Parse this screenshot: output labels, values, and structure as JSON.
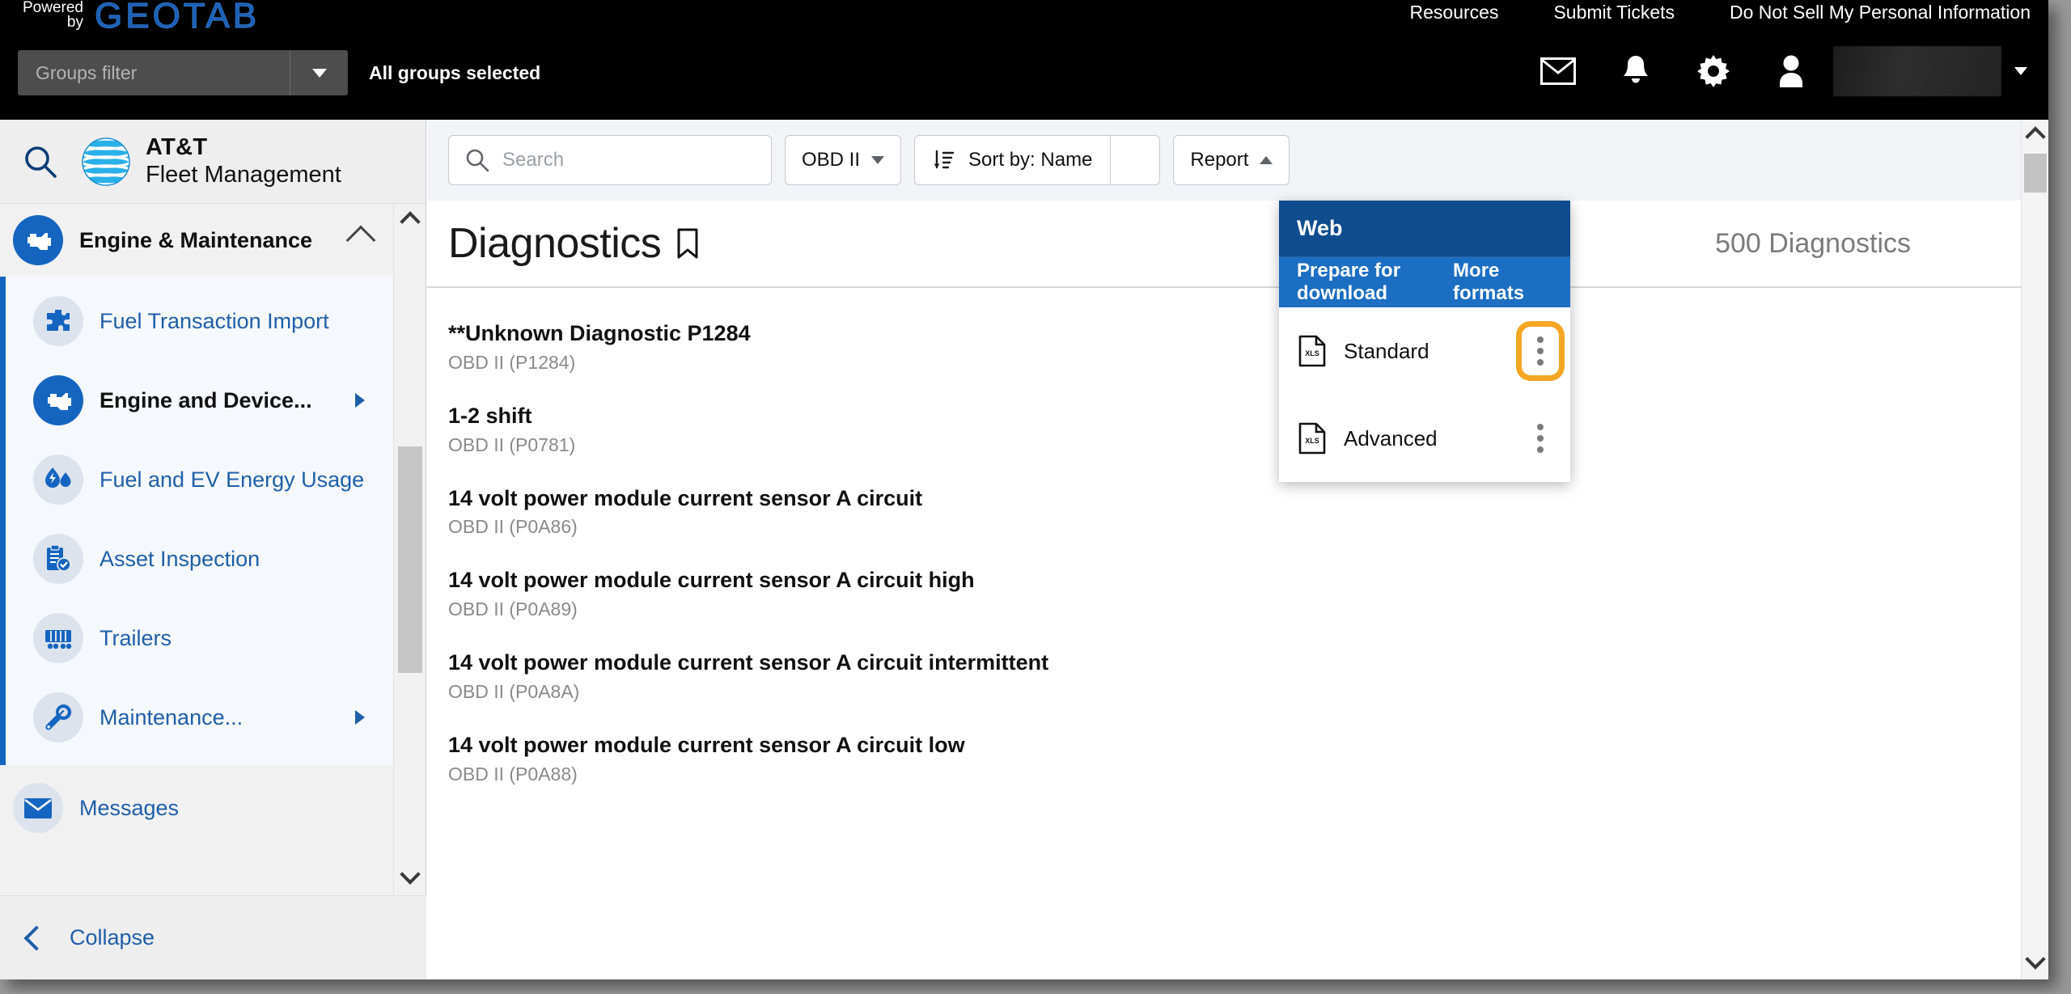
{
  "topbar": {
    "powered_line1": "Powered",
    "powered_line2": "by",
    "geotab": "GEOTAB",
    "groups_placeholder": "Groups filter",
    "groups_status": "All groups selected",
    "links": [
      {
        "label": "Resources"
      },
      {
        "label": "Submit Tickets"
      },
      {
        "label": "Do Not Sell My Personal Information"
      }
    ],
    "icons": [
      {
        "name": "mail-icon"
      },
      {
        "name": "bell-icon"
      },
      {
        "name": "gear-icon"
      },
      {
        "name": "person-icon"
      }
    ]
  },
  "sidebar": {
    "brand_line1": "AT&T",
    "brand_line2": "Fleet Management",
    "group": {
      "label": "Engine & Maintenance",
      "icon": "engine-icon",
      "expanded": true
    },
    "items": [
      {
        "label": "Fuel Transaction Import",
        "icon": "puzzle-icon",
        "active": false,
        "has_submenu": false
      },
      {
        "label": "Engine and Device...",
        "icon": "engine-icon",
        "active": true,
        "has_submenu": true
      },
      {
        "label": "Fuel and EV Energy Usage",
        "icon": "fuel-ev-icon",
        "active": false,
        "has_submenu": false
      },
      {
        "label": "Asset Inspection",
        "icon": "clipboard-check-icon",
        "active": false,
        "has_submenu": false
      },
      {
        "label": "Trailers",
        "icon": "trailer-icon",
        "active": false,
        "has_submenu": false
      },
      {
        "label": "Maintenance...",
        "icon": "wrench-icon",
        "active": false,
        "has_submenu": true
      }
    ],
    "messages": {
      "label": "Messages",
      "icon": "envelope-icon"
    },
    "collapse": {
      "label": "Collapse",
      "icon": "chevron-left-icon"
    }
  },
  "toolbar": {
    "search_placeholder": "Search",
    "filter_label": "OBD II",
    "sort_label": "Sort by:  Name",
    "report_label": "Report"
  },
  "page": {
    "title": "Diagnostics",
    "bookmark_icon": "bookmark-icon",
    "count": "500 Diagnostics"
  },
  "menu": {
    "web_label": "Web",
    "prepare_label": "Prepare for download",
    "more_formats_label": "More formats",
    "items": [
      {
        "label": "Standard",
        "icon": "xls-file-icon",
        "highlighted": true
      },
      {
        "label": "Advanced",
        "icon": "xls-file-icon",
        "highlighted": false
      }
    ]
  },
  "diagnostics": [
    {
      "name": "**Unknown Diagnostic P1284",
      "code": "OBD II (P1284)"
    },
    {
      "name": "1-2 shift",
      "code": "OBD II (P0781)"
    },
    {
      "name": "14 volt power module current sensor A circuit",
      "code": "OBD II (P0A86)"
    },
    {
      "name": "14 volt power module current sensor A circuit high",
      "code": "OBD II (P0A89)"
    },
    {
      "name": "14 volt power module current sensor A circuit intermittent",
      "code": "OBD II (P0A8A)"
    },
    {
      "name": "14 volt power module current sensor A circuit low",
      "code": "OBD II (P0A88)"
    }
  ],
  "colors": {
    "geotab_blue": "#1a5fb4",
    "att_blue": "#1565C0",
    "menu_header_blue": "#0e4c8e",
    "menu_sub_blue": "#1b6ec2",
    "highlight_orange": "#F5A623"
  }
}
